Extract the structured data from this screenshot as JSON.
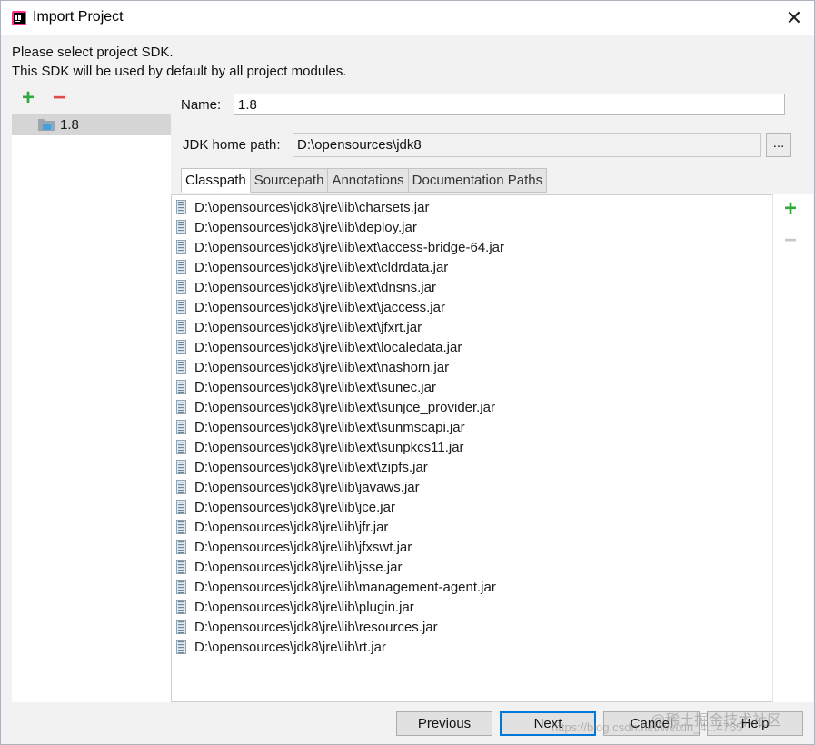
{
  "window": {
    "title": "Import Project",
    "close_glyph": "✕"
  },
  "intro": {
    "line1": "Please select project SDK.",
    "line2": "This SDK will be used by default by all project modules."
  },
  "sdk_panel": {
    "add_glyph": "+",
    "remove_glyph": "−",
    "items": [
      {
        "label": "1.8",
        "icon": "folder-icon",
        "selected": true
      }
    ]
  },
  "form": {
    "name_label": "Name:",
    "name_value": "1.8",
    "jdk_label": "JDK home path:",
    "jdk_value": "D:\\opensources\\jdk8",
    "browse_label": "..."
  },
  "tabs": [
    {
      "label": "Classpath",
      "active": true
    },
    {
      "label": "Sourcepath",
      "active": false
    },
    {
      "label": "Annotations",
      "active": false
    },
    {
      "label": "Documentation Paths",
      "active": false
    }
  ],
  "classpath": [
    "D:\\opensources\\jdk8\\jre\\lib\\charsets.jar",
    "D:\\opensources\\jdk8\\jre\\lib\\deploy.jar",
    "D:\\opensources\\jdk8\\jre\\lib\\ext\\access-bridge-64.jar",
    "D:\\opensources\\jdk8\\jre\\lib\\ext\\cldrdata.jar",
    "D:\\opensources\\jdk8\\jre\\lib\\ext\\dnsns.jar",
    "D:\\opensources\\jdk8\\jre\\lib\\ext\\jaccess.jar",
    "D:\\opensources\\jdk8\\jre\\lib\\ext\\jfxrt.jar",
    "D:\\opensources\\jdk8\\jre\\lib\\ext\\localedata.jar",
    "D:\\opensources\\jdk8\\jre\\lib\\ext\\nashorn.jar",
    "D:\\opensources\\jdk8\\jre\\lib\\ext\\sunec.jar",
    "D:\\opensources\\jdk8\\jre\\lib\\ext\\sunjce_provider.jar",
    "D:\\opensources\\jdk8\\jre\\lib\\ext\\sunmscapi.jar",
    "D:\\opensources\\jdk8\\jre\\lib\\ext\\sunpkcs11.jar",
    "D:\\opensources\\jdk8\\jre\\lib\\ext\\zipfs.jar",
    "D:\\opensources\\jdk8\\jre\\lib\\javaws.jar",
    "D:\\opensources\\jdk8\\jre\\lib\\jce.jar",
    "D:\\opensources\\jdk8\\jre\\lib\\jfr.jar",
    "D:\\opensources\\jdk8\\jre\\lib\\jfxswt.jar",
    "D:\\opensources\\jdk8\\jre\\lib\\jsse.jar",
    "D:\\opensources\\jdk8\\jre\\lib\\management-agent.jar",
    "D:\\opensources\\jdk8\\jre\\lib\\plugin.jar",
    "D:\\opensources\\jdk8\\jre\\lib\\resources.jar",
    "D:\\opensources\\jdk8\\jre\\lib\\rt.jar"
  ],
  "side_toolbar": {
    "add_glyph": "+",
    "remove_glyph": "−"
  },
  "buttons": {
    "previous": "Previous",
    "next": "Next",
    "cancel": "Cancel",
    "help": "Help"
  },
  "watermarks": {
    "site": "@稀土掘金技术社区",
    "url": "https://blog.csdn.net/weixin_4...4765"
  },
  "colors": {
    "accent": "#0078d7",
    "add": "#2eaa3a",
    "remove": "#e04b4b",
    "selection": "#d5d5d5"
  }
}
